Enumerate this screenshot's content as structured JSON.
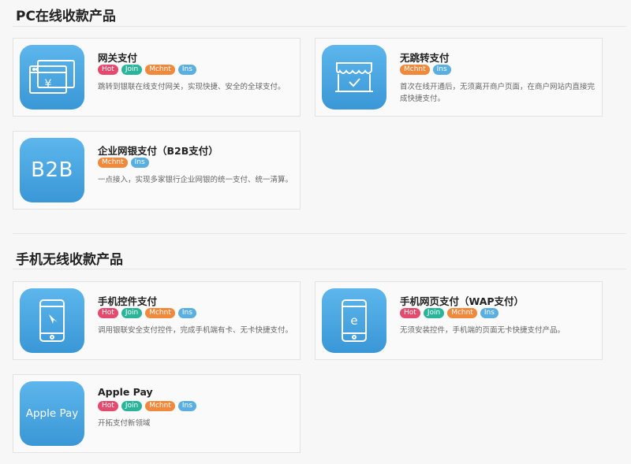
{
  "sections": [
    {
      "title": "PC在线收款产品"
    },
    {
      "title": "手机无线收款产品"
    }
  ],
  "tag_labels": {
    "hot": "Hot",
    "join": "Join",
    "mchnt": "Mchnt",
    "ins": "Ins"
  },
  "products": [
    {
      "name": "网关支付",
      "desc": "跳转到银联在线支付网关，实现快捷、安全的全球支付。",
      "icon": "browser-yen-icon"
    },
    {
      "name": "无跳转支付",
      "desc": "首次在线开通后，无须离开商户页面，在商户网站内直接完成快捷支付。",
      "icon": "storefront-icon"
    },
    {
      "name": "企业网银支付（B2B支付）",
      "desc": "一点接入，实现多家银行企业网银的统一支付、统一清算。",
      "icon_text": "B2B"
    },
    {
      "name": "手机控件支付",
      "desc": "调用银联安全支付控件，完成手机端有卡、无卡快捷支付。",
      "icon": "phone-cursor-icon"
    },
    {
      "name": "手机网页支付（WAP支付）",
      "desc": "无须安装控件，手机端的页面无卡快捷支付产品。",
      "icon": "phone-e-icon"
    },
    {
      "name": "Apple Pay",
      "desc": "开拓支付新领域",
      "icon_text": "Apple Pay"
    }
  ],
  "colors": {
    "icon_gradient_top": "#5db6ec",
    "icon_gradient_bottom": "#3a97d6",
    "hot": "#e44a6d",
    "join": "#2ab59b",
    "mchnt": "#f0893b",
    "ins": "#5aaee0"
  }
}
